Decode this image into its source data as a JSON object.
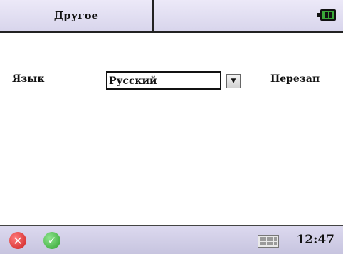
{
  "header": {
    "title": "Другое",
    "battery_icon": "battery-icon"
  },
  "settings": {
    "language_label": "Язык",
    "language_value": "Русский",
    "dropdown_icon": "chevron-down-icon",
    "restart_label": "Перезап"
  },
  "footer": {
    "cancel_icon": "close-icon",
    "ok_icon": "check-icon",
    "keyboard_icon": "keyboard-icon",
    "time": "12:47"
  },
  "colors": {
    "cancel": "#cc1f1f",
    "ok": "#2ea12e",
    "battery": "#3aa838"
  }
}
